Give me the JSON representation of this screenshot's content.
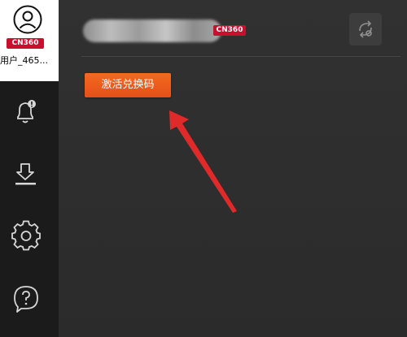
{
  "profile": {
    "badge": "CN360",
    "username": "用户_465..."
  },
  "header": {
    "badge": "CN360"
  },
  "main": {
    "activate_label": "激活兑换码"
  },
  "sidebar": {
    "items": [
      {
        "name": "notifications",
        "icon": "bell-icon"
      },
      {
        "name": "downloads",
        "icon": "download-icon"
      },
      {
        "name": "settings",
        "icon": "gear-icon"
      },
      {
        "name": "help",
        "icon": "question-icon"
      }
    ]
  },
  "colors": {
    "accent": "#e5501a",
    "badge": "#c8102e",
    "sidebar": "#1b1b1c",
    "annotation_arrow": "#e02a2a"
  }
}
